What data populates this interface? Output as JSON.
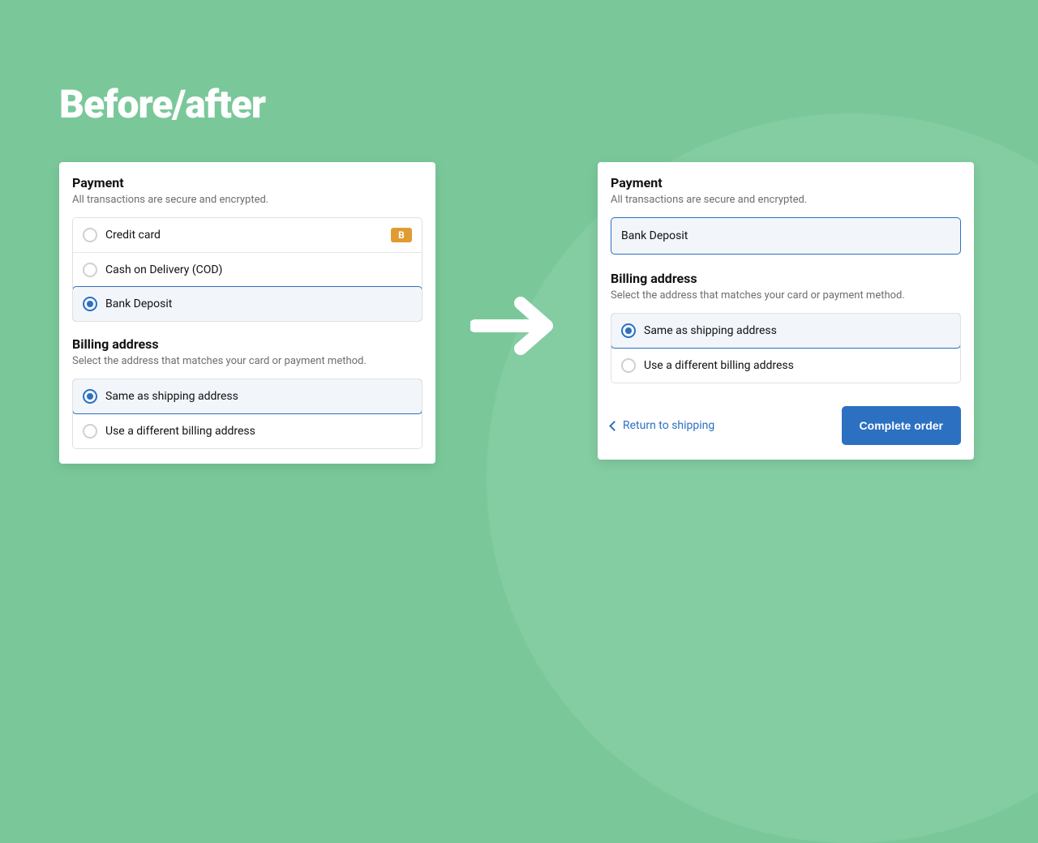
{
  "page_title": "Before/after",
  "badges": {
    "b": "B"
  },
  "before": {
    "payment": {
      "title": "Payment",
      "subtitle": "All transactions are secure and encrypted.",
      "options": {
        "credit_card": "Credit card",
        "cod": "Cash on Delivery (COD)",
        "bank_deposit": "Bank Deposit"
      }
    },
    "billing": {
      "title": "Billing address",
      "subtitle": "Select the address that matches your card or payment method.",
      "options": {
        "same": "Same as shipping address",
        "different": "Use a different billing address"
      }
    }
  },
  "after": {
    "payment": {
      "title": "Payment",
      "subtitle": "All transactions are secure and encrypted.",
      "selected": "Bank Deposit"
    },
    "billing": {
      "title": "Billing address",
      "subtitle": "Select the address that matches your card or payment method.",
      "options": {
        "same": "Same as shipping address",
        "different": "Use a different billing address"
      }
    },
    "footer": {
      "return_link": "Return to shipping",
      "complete_button": "Complete order"
    }
  }
}
